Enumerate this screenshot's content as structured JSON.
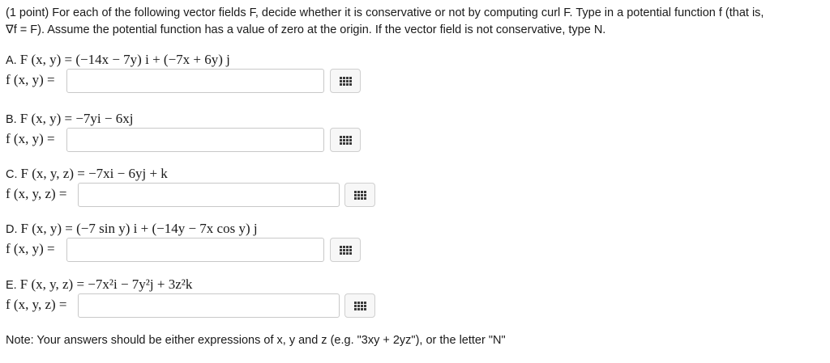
{
  "intro": {
    "line1": "(1 point) For each of the following vector fields F, decide whether it is conservative or not by computing curl F. Type in a potential function f (that is,",
    "line2": "∇f = F). Assume the potential function has a value of zero at the origin. If the vector field is not conservative, type N."
  },
  "parts": [
    {
      "label": "A.",
      "field": "F (x, y) = (−14x − 7y) i + (−7x + 6y) j",
      "potential": "f (x, y) =",
      "value": ""
    },
    {
      "label": "B.",
      "field": "F (x, y) = −7yi − 6xj",
      "potential": "f (x, y) =",
      "value": ""
    },
    {
      "label": "C.",
      "field": "F (x, y, z) = −7xi − 6yj + k",
      "potential": "f (x, y, z) =",
      "value": ""
    },
    {
      "label": "D.",
      "field": "F (x, y) = (−7 sin y) i + (−14y − 7x cos y) j",
      "potential": "f (x, y) =",
      "value": ""
    },
    {
      "label": "E.",
      "field": "F (x, y, z) = −7x²i − 7y²j + 3z²k",
      "potential": "f (x, y, z) =",
      "value": ""
    }
  ],
  "note": "Note: Your answers should be either expressions of x, y and z (e.g. \"3xy + 2yz\"), or the letter \"N\""
}
